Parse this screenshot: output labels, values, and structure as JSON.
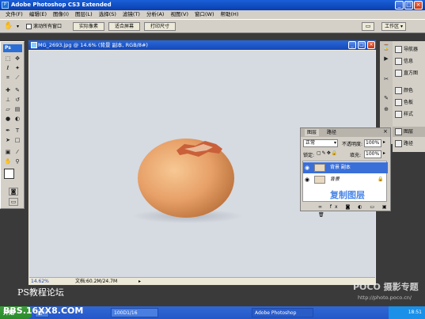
{
  "window": {
    "title": "Adobe Photoshop CS3 Extended",
    "minimize": "_",
    "maximize": "□",
    "close": "×"
  },
  "menu": [
    "文件(F)",
    "编辑(E)",
    "图像(I)",
    "图层(L)",
    "选择(S)",
    "滤镜(T)",
    "分析(A)",
    "视图(V)",
    "窗口(W)",
    "帮助(H)"
  ],
  "options": {
    "checkbox_label": "滚动所有窗口",
    "actual_pixels": "实际像素",
    "fit_screen": "适合屏幕",
    "print_size": "打印尺寸",
    "workspace": "工作区 ▾"
  },
  "toolbox": {
    "badge": "Ps"
  },
  "document": {
    "title": "MG_2693.jpg @ 14.6% (背景 副本, RGB/8#)",
    "zoom": "14.62%",
    "doc_info": "文档:60.2M/24.7M"
  },
  "dock": {
    "items": [
      "导航器",
      "信息",
      "直方图",
      "颜色",
      "色板",
      "样式",
      "图层",
      "路径"
    ]
  },
  "layers_panel": {
    "tabs": [
      "图层",
      "路径"
    ],
    "blend_mode": "正常",
    "opacity_label": "不透明度:",
    "opacity_value": "100%",
    "lock_label": "锁定:",
    "fill_label": "填充:",
    "fill_value": "100%",
    "layers": [
      {
        "name": "背景 副本",
        "selected": true
      },
      {
        "name": "背景",
        "selected": false
      }
    ],
    "annotation": "复制图层"
  },
  "watermark": {
    "left_top": "PS教程论坛",
    "left_bottom": "BBS.16XX8.COM",
    "right_brand": "POCO 摄影专题",
    "right_url": "http://photo.poco.cn/"
  },
  "taskbar": {
    "start": "开始",
    "tasks": [
      "",
      "100D1/16",
      "Adobe Photoshop"
    ],
    "clock": "18:51"
  },
  "colors": {
    "egg": "#e7a067",
    "canvas": "#d6dae1",
    "selected_layer": "#3a6fd8"
  }
}
